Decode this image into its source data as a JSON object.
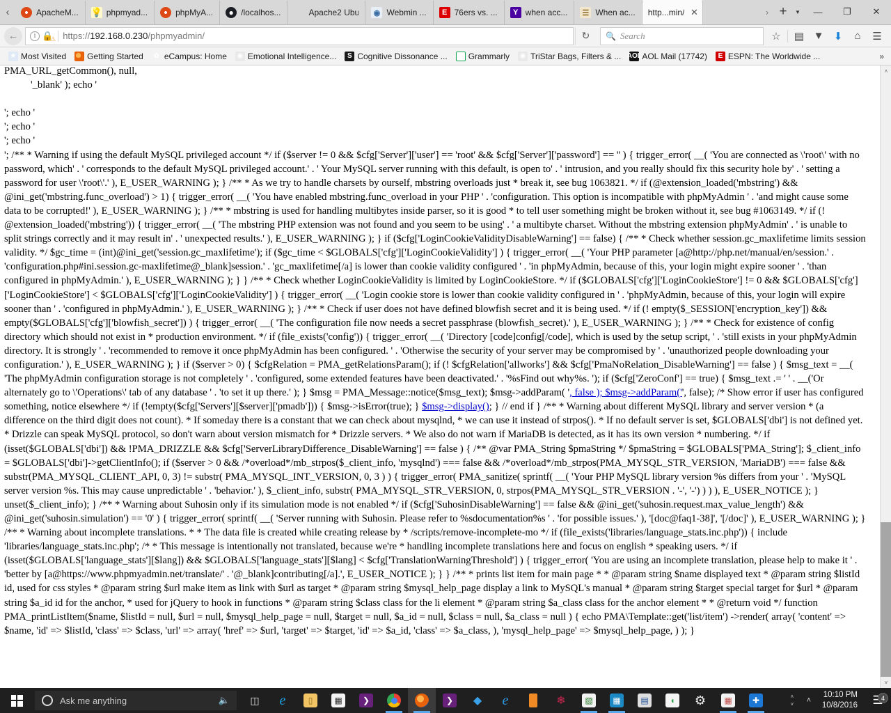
{
  "browser": {
    "tabs": [
      {
        "label": "ApacheM...",
        "icon": "ubuntu-icon",
        "active": false
      },
      {
        "label": "phpmyad...",
        "icon": "lightbulb-icon",
        "active": false
      },
      {
        "label": "phpMyA...",
        "icon": "ubuntu-icon",
        "active": false
      },
      {
        "label": "/localhos...",
        "icon": "github-icon",
        "active": false
      },
      {
        "label": "Apache2 Ubu...",
        "icon": "blank-icon",
        "active": false
      },
      {
        "label": "Webmin ...",
        "icon": "webmin-icon",
        "active": false
      },
      {
        "label": "76ers vs. ...",
        "icon": "espn-icon",
        "active": false
      },
      {
        "label": "when acc...",
        "icon": "yahoo-icon",
        "active": false
      },
      {
        "label": "When ac...",
        "icon": "document-icon",
        "active": false
      },
      {
        "label": "http...min/",
        "icon": "none",
        "active": true
      }
    ],
    "tab_close_label": "✕",
    "tab_scroll_left": "‹",
    "tab_scroll_right": "›",
    "newtab_label": "+",
    "newtab_caret": "▼",
    "window_minimize": "—",
    "window_restore": "❐",
    "window_close": "✕",
    "nav": {
      "back_label": "←",
      "reload_label": "↻",
      "url_scheme": "https://",
      "url_host": "192.168.0.230",
      "url_path": "/phpmyadmin/",
      "identity_info": "i",
      "identity_lock": "🔒",
      "identity_warning": "⚠",
      "search_placeholder": "Search",
      "search_value": "",
      "search_icon": "🔍",
      "icons": [
        {
          "name": "bookmark-star-icon",
          "glyph": "☆"
        },
        {
          "name": "reader-view-icon",
          "glyph": "▤"
        },
        {
          "name": "pocket-icon",
          "glyph": "▼"
        },
        {
          "name": "downloads-icon",
          "glyph": "⬇"
        },
        {
          "name": "home-icon",
          "glyph": "⌂"
        },
        {
          "name": "menu-icon",
          "glyph": "☰"
        }
      ]
    },
    "bookmarks": [
      {
        "label": "Most Visited",
        "icon": "most-visited-icon"
      },
      {
        "label": "Getting Started",
        "icon": "firefox-icon"
      },
      {
        "label": "eCampus: Home",
        "icon": "ecampus-icon"
      },
      {
        "label": "Emotional Intelligence...",
        "icon": "globe-icon"
      },
      {
        "label": "Cognitive Dissonance ...",
        "icon": "scribd-icon"
      },
      {
        "label": "Grammarly",
        "icon": "grammarly-icon"
      },
      {
        "label": "TriStar Bags, Filters & ...",
        "icon": "globe-icon"
      },
      {
        "label": "AOL Mail (17742)",
        "icon": "aol-icon"
      },
      {
        "label": "ESPN: The Worldwide ...",
        "icon": "espn-icon"
      }
    ],
    "bookmarks_overflow": "»",
    "scrollbar": {
      "up_arrow": "˄",
      "mid_arrow": "˅",
      "down_arrow": "˅"
    }
  },
  "page": {
    "link_color": "#0000cc",
    "line_truncated_top": "PMA_printListItem( __( 'Support' ), 'pma_support', 'https://www.phpmyadmin.net/support/', null, '_blank' ); PMA_printListItem( __( 'List of changes' ), 'pma_changes', 'changelog.php' . PMA_URL_getCommon(), null,",
    "line_indent_2": "'_blank' ); echo '",
    "echo_lines": [
      "'; echo '",
      "'; echo '",
      "'; echo '"
    ],
    "body_part_1": "'; /** * Warning if using the default MySQL privileged account */ if ($server != 0 && $cfg['Server']['user'] == 'root' && $cfg['Server']['password'] == '' ) { trigger_error( __( 'You are connected as \\'root\\' with no password, which' . ' corresponds to the default MySQL privileged account.' . ' Your MySQL server running with this default, is open to' . ' intrusion, and you really should fix this security hole by' . ' setting a password for user \\'root\\'.' ), E_USER_WARNING ); } /** * As we try to handle charsets by ourself, mbstring overloads just * break it, see bug 1063821. */ if (@extension_loaded('mbstring') && @ini_get('mbstring.func_overload') > 1) { trigger_error( __( 'You have enabled mbstring.func_overload in your PHP ' . 'configuration. This option is incompatible with phpMyAdmin ' . 'and might cause some data to be corrupted!' ), E_USER_WARNING ); } /** * mbstring is used for handling multibytes inside parser, so it is good * to tell user something might be broken without it, see bug #1063149. */ if (! @extension_loaded('mbstring')) { trigger_error( __( 'The mbstring PHP extension was not found and you seem to be using' . ' a multibyte charset. Without the mbstring extension phpMyAdmin' . ' is unable to split strings correctly and it may result in' . ' unexpected results.' ), E_USER_WARNING ); } if ($cfg['LoginCookieValidityDisableWarning'] == false) { /** * Check whether session.gc_maxlifetime limits session validity. */ $gc_time = (int)@ini_get('session.gc_maxlifetime'); if ($gc_time < $GLOBALS['cfg']['LoginCookieValidity'] ) { trigger_error( __( 'Your PHP parameter [a@http://php.net/manual/en/session.' . 'configuration.php#ini.session.gc-maxlifetime@_blank]session.' . 'gc_maxlifetime[/a] is lower than cookie validity configured ' . 'in phpMyAdmin, because of this, your login might expire sooner ' . 'than configured in phpMyAdmin.' ), E_USER_WARNING ); } } /** * Check whether LoginCookieValidity is limited by LoginCookieStore. */ if ($GLOBALS['cfg']['LoginCookieStore'] != 0 && $GLOBALS['cfg']['LoginCookieStore'] < $GLOBALS['cfg']['LoginCookieValidity'] ) { trigger_error( __( 'Login cookie store is lower than cookie validity configured in ' . 'phpMyAdmin, because of this, your login will expire sooner than ' . 'configured in phpMyAdmin.' ), E_USER_WARNING ); } /** * Check if user does not have defined blowfish secret and it is being used. */ if (! empty($_SESSION['encryption_key']) && empty($GLOBALS['cfg']['blowfish_secret']) ) { trigger_error( __( 'The configuration file now needs a secret passphrase (blowfish_secret).' ), E_USER_WARNING ); } /** * Check for existence of config directory which should not exist in * production environment. */ if (file_exists('config')) { trigger_error( __( 'Directory [code]config[/code], which is used by the setup script, ' . 'still exists in your phpMyAdmin directory. It is strongly ' . 'recommended to remove it once phpMyAdmin has been configured. ' . 'Otherwise the security of your server may be compromised by ' . 'unauthorized people downloading your configuration.' ), E_USER_WARNING ); } if ($server > 0) { $cfgRelation = PMA_getRelationsParam(); if (! $cfgRelation['allworks'] && $cfg['PmaNoRelation_DisableWarning'] == false ) { $msg_text = __( 'The phpMyAdmin configuration storage is not completely ' . 'configured, some extended features have been deactivated.' . '%sFind out why%s. '); if ($cfg['ZeroConf'] == true) { $msg_text .= '",
    "body_part_2": " ' . __('Or alternately go to \\'Operations\\' tab of any database ' . 'to set it up there.' ); } $msg = PMA_Message::notice($msg_text); $msg->addParam( '",
    "link_1": ", false ); $msg->addParam('",
    "body_part_3": "', false); /* Show error if user has configured something, notice elsewhere */ if (!empty($cfg['Servers'][$server]['pmadb'])) { $msg->isError(true); } ",
    "link_2": "$msg->display()",
    "body_part_4": "; } // end if } /** * Warning about different MySQL library and server version * (a difference on the third digit does not count). * If someday there is a constant that we can check about mysqlnd, * we can use it instead of strpos(). * If no default server is set, $GLOBALS['dbi'] is not defined yet. * Drizzle can speak MySQL protocol, so don't warn about version mismatch for * Drizzle servers. * We also do not warn if MariaDB is detected, as it has its own version * numbering. */ if (isset($GLOBALS['dbi']) && !PMA_DRIZZLE && $cfg['ServerLibraryDifference_DisableWarning'] == false ) { /** @var PMA_String $pmaString */ $pmaString = $GLOBALS['PMA_String']; $_client_info = $GLOBALS['dbi']->getClientInfo(); if ($server > 0 && /*overload*/mb_strpos($_client_info, 'mysqlnd') === false && /*overload*/mb_strpos(PMA_MYSQL_STR_VERSION, 'MariaDB') === false && substr(PMA_MYSQL_CLIENT_API, 0, 3) != substr( PMA_MYSQL_INT_VERSION, 0, 3 ) ) { trigger_error( PMA_sanitize( sprintf( __( 'Your PHP MySQL library version %s differs from your ' . 'MySQL server version %s. This may cause unpredictable ' . 'behavior.' ), $_client_info, substr( PMA_MYSQL_STR_VERSION, 0, strpos(PMA_MYSQL_STR_VERSION . '-', '-') ) ) ), E_USER_NOTICE ); } unset($_client_info); } /** * Warning about Suhosin only if its simulation mode is not enabled */ if ($cfg['SuhosinDisableWarning'] == false && @ini_get('suhosin.request.max_value_length') && @ini_get('suhosin.simulation') == '0' ) { trigger_error( sprintf( __( 'Server running with Suhosin. Please refer to %sdocumentation%s ' . 'for possible issues.' ), '[doc@faq1-38]', '[/doc]' ), E_USER_WARNING ); } /** * Warning about incomplete translations. * * The data file is created while creating release by * /scripts/remove-incomplete-mo */ if (file_exists('libraries/language_stats.inc.php')) { include 'libraries/language_stats.inc.php'; /* * This message is intentionally not translated, because we're * handling incomplete translations here and focus on english * speaking users. */ if (isset($GLOBALS['language_stats'][$lang]) && $GLOBALS['language_stats'][$lang] < $cfg['TranslationWarningThreshold'] ) { trigger_error( 'You are using an incomplete translation, please help to make it ' . 'better by [a@https://www.phpmyadmin.net/translate/' . '@_blank]contributing[/a].', E_USER_NOTICE ); } } /** * prints list item for main page * * @param string $name displayed text * @param string $listId id, used for css styles * @param string $url make item as link with $url as target * @param string $mysql_help_page display a link to MySQL's manual * @param string $target special target for $url * @param string $a_id id for the anchor, * used for jQuery to hook in functions * @param string $class class for the li element * @param string $a_class class for the anchor element * * @return void */ function PMA_printListItem($name, $listId = null, $url = null, $mysql_help_page = null, $target = null, $a_id = null, $class = null, $a_class = null ) { echo PMA\\Template::get('list/item') ->render( array( 'content' => $name, 'id' => $listId, 'class' => $class, 'url' => array( 'href' => $url, 'target' => $target, 'id' => $a_id, 'class' => $a_class, ), 'mysql_help_page' => $mysql_help_page, ) ); }"
  },
  "taskbar": {
    "start_label": "Start",
    "cortana_placeholder": "Ask me anything",
    "cortana_value": "",
    "mic_icon": "🎙",
    "items": [
      {
        "name": "task-view-button",
        "glyph": "▭"
      },
      {
        "name": "edge-icon",
        "glyph": "e"
      },
      {
        "name": "file-explorer-icon",
        "glyph": "🗀"
      },
      {
        "name": "store-icon",
        "glyph": "🛍"
      },
      {
        "name": "visual-studio-code-icon",
        "glyph": "⬡"
      },
      {
        "name": "chrome-icon",
        "glyph": "◉"
      },
      {
        "name": "firefox-icon",
        "glyph": "◉"
      },
      {
        "name": "visual-studio-icon",
        "glyph": "∞"
      },
      {
        "name": "filezilla-icon",
        "glyph": "◆"
      },
      {
        "name": "internet-explorer-icon",
        "glyph": "e"
      },
      {
        "name": "notepad-plus-icon",
        "glyph": "▐"
      },
      {
        "name": "raspberry-pi-icon",
        "glyph": "❀"
      },
      {
        "name": "spreadsheet-icon",
        "glyph": "▤"
      },
      {
        "name": "server-manager-icon",
        "glyph": "▦"
      },
      {
        "name": "putty-icon",
        "glyph": "🖥"
      },
      {
        "name": "wifi-manager-icon",
        "glyph": "◠"
      },
      {
        "name": "settings-gear-icon",
        "glyph": "⚙"
      },
      {
        "name": "powerpoint-icon",
        "glyph": "■"
      },
      {
        "name": "windows-defender-icon",
        "glyph": "❖"
      }
    ],
    "tray_up_arrow": "˄",
    "time": "10:10 PM",
    "date": "10/8/2016",
    "notification_count": "4",
    "notification_icon": "▤"
  }
}
